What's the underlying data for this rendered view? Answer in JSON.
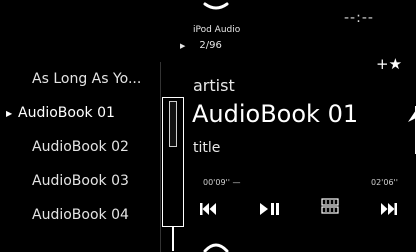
{
  "header": {
    "source_label": "iPod Audio",
    "track_position": "2/96",
    "clock": "--:--"
  },
  "track_list": {
    "items": [
      {
        "label": "As Long As Yo...",
        "selected": false
      },
      {
        "label": "AudioBook 01",
        "selected": true
      },
      {
        "label": "AudioBook 02",
        "selected": false
      },
      {
        "label": "AudioBook 03",
        "selected": false
      },
      {
        "label": "AudioBook 04",
        "selected": false
      }
    ]
  },
  "now_playing": {
    "artist": "artist",
    "title": "AudioBook 01",
    "album": "title",
    "elapsed": "00'09'' —",
    "total": "02'06''",
    "favorite_label": "+★"
  },
  "controls": {
    "previous_icon": "skip-previous-icon",
    "play_pause_icon": "play-pause-icon",
    "repeat_icon": "repeat-icon",
    "next_icon": "skip-next-icon"
  },
  "colors": {
    "background": "#000000",
    "text": "#ffffff",
    "secondary_text": "#cfcfcf"
  }
}
